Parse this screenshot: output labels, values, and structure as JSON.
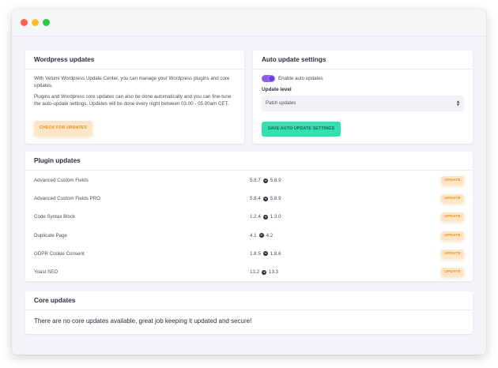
{
  "window": {
    "controls": {
      "close_color": "#ff5f57",
      "minimize_color": "#febc2e",
      "zoom_color": "#28c840"
    }
  },
  "wordpress_updates": {
    "title": "Wordpress updates",
    "paragraph_1": "With Velumi Wordpress Update Center, you can manage your Wordpress plugins and core updates.",
    "paragraph_2": "Plugins and Wordpress core updates can also be done automatically and you can fine-tune the auto-update settings. Updates will be done every night between 03.00 - 05.00am CET.",
    "check_button": "CHECK FOR UPDATES"
  },
  "auto_update": {
    "title": "Auto update settings",
    "toggle_label": "Enable auto updates",
    "toggle_on": true,
    "level_label": "Update level",
    "level_value": "Patch updates",
    "save_button": "SAVE AUTO UPDATE SETTINGS"
  },
  "plugin_updates": {
    "title": "Plugin updates",
    "update_label": "UPDATE",
    "rows": [
      {
        "name": "Advanced Custom Fields",
        "from": "5.8.7",
        "to": "5.8.9"
      },
      {
        "name": "Advanced Custom Fields PRO",
        "from": "5.8.4",
        "to": "5.8.9"
      },
      {
        "name": "Code Syntax Block",
        "from": "1.2.4",
        "to": "1.3.0"
      },
      {
        "name": "Duplicate Page",
        "from": "4.1",
        "to": "4.2"
      },
      {
        "name": "GDPR Cookie Consent",
        "from": "1.8.5",
        "to": "1.8.6"
      },
      {
        "name": "Yoast SEO",
        "from": "13.2",
        "to": "13.3"
      }
    ]
  },
  "core_updates": {
    "title": "Core updates",
    "message": "There are no core updates available, great job keeping it updated and secure!"
  },
  "colors": {
    "accent_orange": "#e98a1c",
    "accent_green": "#34e0b0",
    "toggle_purple": "#8b5cf6"
  }
}
